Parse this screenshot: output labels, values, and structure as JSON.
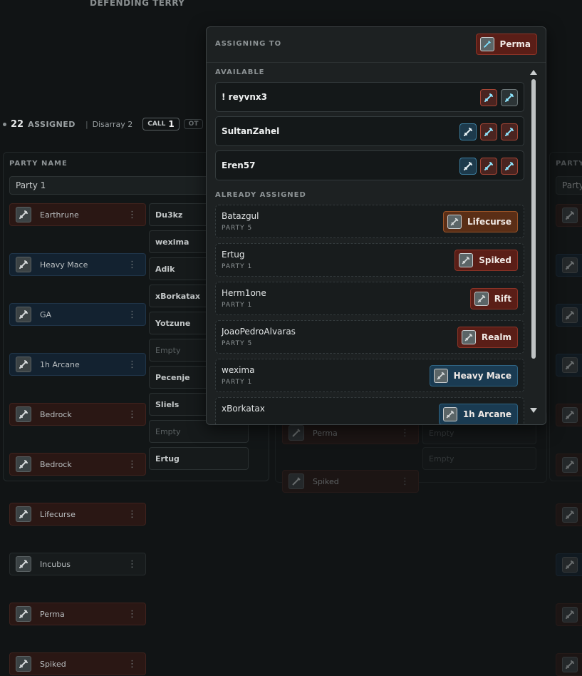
{
  "page": {
    "heading": "DEFENDING TERRY"
  },
  "stats": {
    "count": "22",
    "assigned_label": "ASSIGNED",
    "divider": "|",
    "disarray": "Disarray 2",
    "call_label": "CALL",
    "call_count": "1",
    "other_label": "OT"
  },
  "left_panel": {
    "party_label": "PARTY NAME",
    "party_value": "Party 1",
    "rows": [
      {
        "role": "Earthrune",
        "tone": "red",
        "player": "Du3kz",
        "empty": false
      },
      {
        "role": "Heavy Mace",
        "tone": "blue",
        "player": "wexima",
        "empty": false
      },
      {
        "role": "GA",
        "tone": "blue",
        "player": "Adik",
        "empty": false
      },
      {
        "role": "1h Arcane",
        "tone": "blue",
        "player": "xBorkatax",
        "empty": false
      },
      {
        "role": "Bedrock",
        "tone": "red",
        "player": "Yotzune",
        "empty": false
      },
      {
        "role": "Bedrock",
        "tone": "red",
        "player": "Empty",
        "empty": true
      },
      {
        "role": "Lifecurse",
        "tone": "red",
        "player": "Pecenje",
        "empty": false
      },
      {
        "role": "Incubus",
        "tone": "none",
        "player": "Sliels",
        "empty": false
      },
      {
        "role": "Perma",
        "tone": "red",
        "player": "Empty",
        "empty": true
      },
      {
        "role": "Spiked",
        "tone": "red",
        "player": "Ertug",
        "empty": false
      }
    ]
  },
  "middle_panel": {
    "rows": [
      {
        "role": "Perma",
        "player": "Empty"
      },
      {
        "role": "Spiked",
        "player": "Empty"
      }
    ]
  },
  "right_panel": {
    "party_label": "PARTY",
    "party_value": "Party"
  },
  "popup": {
    "header_label": "ASSIGNING TO",
    "target_role": "Perma",
    "available_label": "AVAILABLE",
    "available": [
      {
        "name": "! reyvnx3",
        "icons": [
          "red",
          "grey"
        ]
      },
      {
        "name": "SultanZahel",
        "icons": [
          "blue",
          "red",
          "red"
        ]
      },
      {
        "name": "Eren57",
        "icons": [
          "blue",
          "red",
          "red"
        ]
      }
    ],
    "assigned_label": "ALREADY ASSIGNED",
    "assigned": [
      {
        "name": "Batazgul",
        "party": "PARTY 5",
        "role": "Lifecurse",
        "tone": "brown"
      },
      {
        "name": "Ertug",
        "party": "PARTY 1",
        "role": "Spiked",
        "tone": "red"
      },
      {
        "name": "Herm1one",
        "party": "PARTY 1",
        "role": "Rift",
        "tone": "red"
      },
      {
        "name": "JoaoPedroAlvaras",
        "party": "PARTY 5",
        "role": "Realm",
        "tone": "red"
      },
      {
        "name": "wexima",
        "party": "PARTY 1",
        "role": "Heavy Mace",
        "tone": "blue"
      },
      {
        "name": "xBorkatax",
        "party": "",
        "role": "1h Arcane",
        "tone": "blue"
      }
    ]
  },
  "icons": {
    "role_icon": "weapon-icon",
    "menu_icon": "kebab-menu-icon",
    "scroll_up": "scroll-up-arrow-icon",
    "scroll_down": "scroll-down-arrow-icon"
  }
}
